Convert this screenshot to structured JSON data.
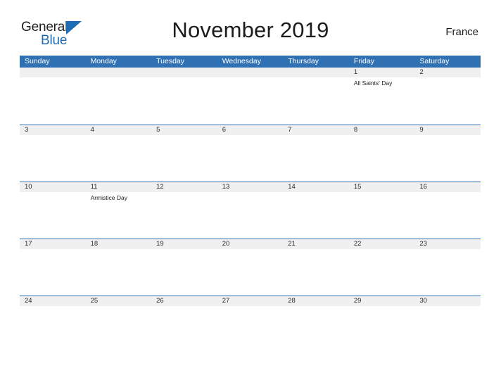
{
  "brand": {
    "name_part1": "General",
    "name_part2": "Blue",
    "triangle_color": "#1d6cb4"
  },
  "header": {
    "title": "November 2019",
    "country": "France"
  },
  "colors": {
    "header_band": "#3071b4",
    "row_divider": "#3071b4",
    "day_band": "#f0f0f0",
    "text": "#1c1c1c"
  },
  "calendar": {
    "month": "November",
    "year": "2019",
    "weekday_headers": [
      "Sunday",
      "Monday",
      "Tuesday",
      "Wednesday",
      "Thursday",
      "Friday",
      "Saturday"
    ],
    "weeks": [
      {
        "days": [
          {
            "num": "",
            "event": ""
          },
          {
            "num": "",
            "event": ""
          },
          {
            "num": "",
            "event": ""
          },
          {
            "num": "",
            "event": ""
          },
          {
            "num": "",
            "event": ""
          },
          {
            "num": "1",
            "event": "All Saints' Day"
          },
          {
            "num": "2",
            "event": ""
          }
        ]
      },
      {
        "days": [
          {
            "num": "3",
            "event": ""
          },
          {
            "num": "4",
            "event": ""
          },
          {
            "num": "5",
            "event": ""
          },
          {
            "num": "6",
            "event": ""
          },
          {
            "num": "7",
            "event": ""
          },
          {
            "num": "8",
            "event": ""
          },
          {
            "num": "9",
            "event": ""
          }
        ]
      },
      {
        "days": [
          {
            "num": "10",
            "event": ""
          },
          {
            "num": "11",
            "event": "Armistice Day"
          },
          {
            "num": "12",
            "event": ""
          },
          {
            "num": "13",
            "event": ""
          },
          {
            "num": "14",
            "event": ""
          },
          {
            "num": "15",
            "event": ""
          },
          {
            "num": "16",
            "event": ""
          }
        ]
      },
      {
        "days": [
          {
            "num": "17",
            "event": ""
          },
          {
            "num": "18",
            "event": ""
          },
          {
            "num": "19",
            "event": ""
          },
          {
            "num": "20",
            "event": ""
          },
          {
            "num": "21",
            "event": ""
          },
          {
            "num": "22",
            "event": ""
          },
          {
            "num": "23",
            "event": ""
          }
        ]
      },
      {
        "days": [
          {
            "num": "24",
            "event": ""
          },
          {
            "num": "25",
            "event": ""
          },
          {
            "num": "26",
            "event": ""
          },
          {
            "num": "27",
            "event": ""
          },
          {
            "num": "28",
            "event": ""
          },
          {
            "num": "29",
            "event": ""
          },
          {
            "num": "30",
            "event": ""
          }
        ]
      }
    ]
  }
}
